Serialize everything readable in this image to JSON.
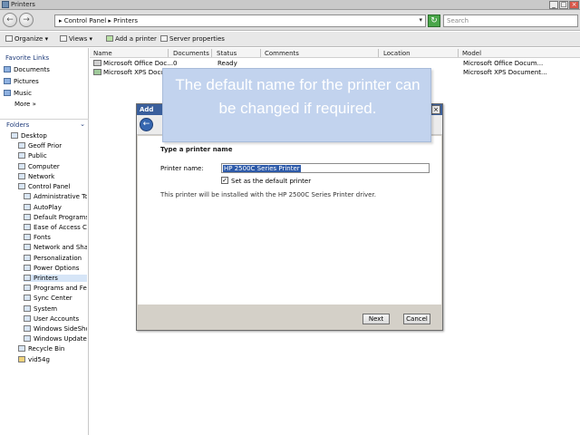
{
  "window": {
    "title": "Printers",
    "minimize": "_",
    "maximize": "□",
    "close": "×"
  },
  "address": {
    "back": "←",
    "forward": "→",
    "crumbs": "▸ Control Panel ▸ Printers",
    "dropdown": "▾",
    "search_placeholder": "Search"
  },
  "toolbar": {
    "organize": "Organize ▾",
    "views": "Views ▾",
    "add_printer": "Add a printer",
    "server_properties": "Server properties"
  },
  "favorites": {
    "title": "Favorite Links",
    "items": [
      "Documents",
      "Pictures",
      "Music"
    ],
    "more": "More »"
  },
  "folders": {
    "title": "Folders",
    "tree": [
      "Desktop",
      "Geoff Prior",
      "Public",
      "Computer",
      "Network",
      "Control Panel",
      "Administrative Tools",
      "AutoPlay",
      "Default Programs",
      "Ease of Access Center",
      "Fonts",
      "Network and Sharing",
      "Personalization",
      "Power Options",
      "Printers",
      "Programs and Features",
      "Sync Center",
      "System",
      "User Accounts",
      "Windows SideShow",
      "Windows Update",
      "Recycle Bin",
      "vid54g"
    ]
  },
  "columns": [
    "Name",
    "Documents",
    "Status",
    "Comments",
    "Location",
    "Model"
  ],
  "printers": [
    {
      "name": "Microsoft Office Doc...",
      "documents": "0",
      "status": "Ready",
      "model": "Microsoft Office Docum..."
    },
    {
      "name": "Microsoft XPS Docum...",
      "documents": "",
      "status": "",
      "model": "Microsoft XPS Document..."
    }
  ],
  "dialog": {
    "title": "Add",
    "close": "×",
    "heading": "Type a printer name",
    "printer_name_label": "Printer name:",
    "printer_name_value": "HP 2500C Series Printer",
    "checkbox_mark": "✓",
    "default_label": "Set as the default printer",
    "note": "This printer will be installed with the HP 2500C Series Printer driver.",
    "next": "Next",
    "cancel": "Cancel"
  },
  "callout": {
    "text": "The default name for the printer can be changed if required."
  }
}
